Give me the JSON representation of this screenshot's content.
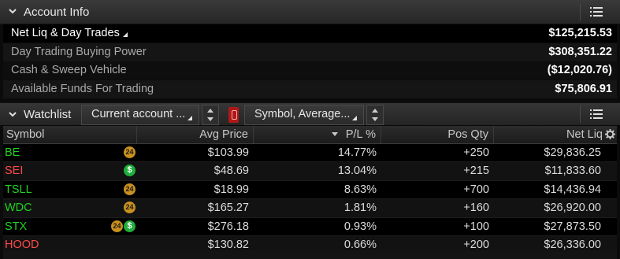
{
  "account_panel": {
    "title": "Account Info",
    "rows": [
      {
        "label": "Net Liq & Day Trades",
        "value": "$125,215.53"
      },
      {
        "label": "Day Trading Buying Power",
        "value": "$308,351.22"
      },
      {
        "label": "Cash & Sweep Vehicle",
        "value": "($12,020.76)"
      },
      {
        "label": "Available Funds For Trading",
        "value": "$75,806.91"
      }
    ]
  },
  "watchlist": {
    "title": "Watchlist",
    "account_dropdown": "Current account ...",
    "columns_dropdown": "Symbol, Average...",
    "headers": {
      "symbol": "Symbol",
      "avg_price": "Avg Price",
      "pl_pct": "P/L %",
      "pos_qty": "Pos Qty",
      "net_liq": "Net Liq"
    },
    "rows": [
      {
        "symbol": "BE",
        "avg_price": "$103.99",
        "pl_pct": "14.77%",
        "pos_qty": "+250",
        "net_liq": "$29,836.25"
      },
      {
        "symbol": "SEI",
        "avg_price": "$48.69",
        "pl_pct": "13.04%",
        "pos_qty": "+215",
        "net_liq": "$11,833.60"
      },
      {
        "symbol": "TSLL",
        "avg_price": "$18.99",
        "pl_pct": "8.63%",
        "pos_qty": "+700",
        "net_liq": "$14,436.94"
      },
      {
        "symbol": "WDC",
        "avg_price": "$165.27",
        "pl_pct": "1.81%",
        "pos_qty": "+160",
        "net_liq": "$26,920.00"
      },
      {
        "symbol": "STX",
        "avg_price": "$276.18",
        "pl_pct": "0.93%",
        "pos_qty": "+100",
        "net_liq": "$27,873.50"
      },
      {
        "symbol": "HOOD",
        "avg_price": "$130.82",
        "pl_pct": "0.66%",
        "pos_qty": "+200",
        "net_liq": "$26,336.00"
      }
    ]
  },
  "badges": {
    "hours24": "24",
    "dollar": "$"
  },
  "colors": {
    "up": "#1fd21f",
    "down": "#ff4a4a",
    "badge24": "#c8901e",
    "badge_dollar": "#1fae3a"
  }
}
